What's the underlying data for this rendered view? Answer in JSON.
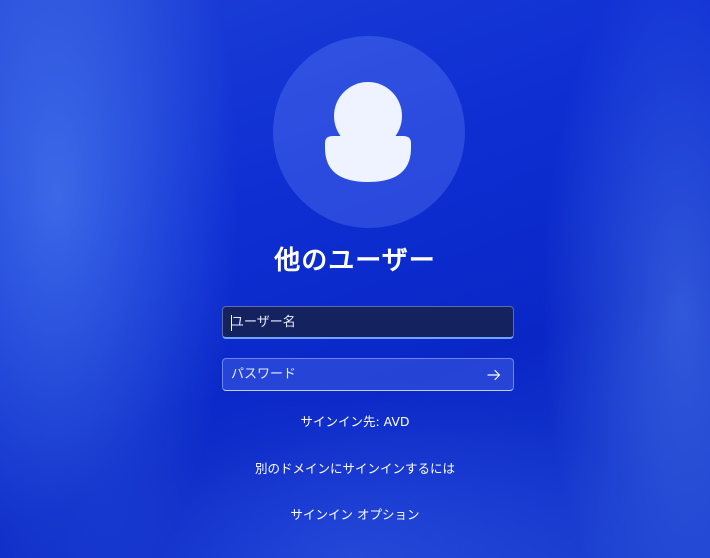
{
  "user": {
    "title": "他のユーザー"
  },
  "username_field": {
    "placeholder": "ユーザー名",
    "value": ""
  },
  "password_field": {
    "placeholder": "パスワード",
    "value": "",
    "submit_icon": "arrow-right-icon"
  },
  "signin_target": "サインイン先: AVD",
  "other_domain_link": "別のドメインにサインインするには",
  "signin_options_link": "サインイン オプション",
  "colors": {
    "background": "#0f2fd3",
    "avatar_fill": "#eef3ff",
    "focus_accent": "#6fa3ff"
  }
}
